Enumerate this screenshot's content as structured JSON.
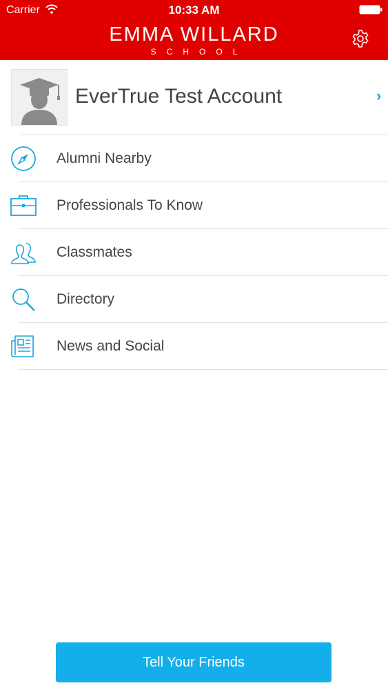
{
  "status_bar": {
    "carrier": "Carrier",
    "time": "10:33 AM",
    "wifi_icon": "wifi-icon",
    "battery_icon": "battery-icon"
  },
  "header": {
    "brand_name": "EMMA WILLARD",
    "brand_sub": "SCHOOL",
    "settings_icon": "gear-icon",
    "background_color": "#e00000"
  },
  "profile": {
    "name": "EverTrue Test Account",
    "avatar_icon": "graduate-avatar-icon",
    "chevron": "›"
  },
  "menu": [
    {
      "label": "Alumni Nearby",
      "icon": "compass-icon"
    },
    {
      "label": "Professionals To Know",
      "icon": "briefcase-icon"
    },
    {
      "label": "Classmates",
      "icon": "people-icon"
    },
    {
      "label": "Directory",
      "icon": "search-icon"
    },
    {
      "label": "News and Social",
      "icon": "newspaper-icon"
    }
  ],
  "footer": {
    "button_label": "Tell Your Friends"
  },
  "colors": {
    "accent": "#1ba7dc",
    "button": "#14aeea",
    "header": "#e00000"
  }
}
